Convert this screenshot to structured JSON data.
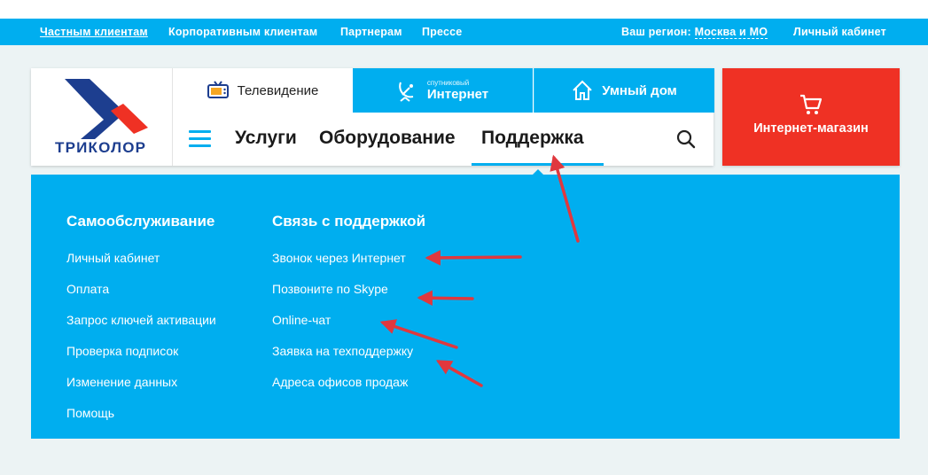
{
  "topbar": {
    "links": [
      "Частным клиентам",
      "Корпоративным клиентам",
      "Партнерам",
      "Прессе"
    ],
    "region_label": "Ваш регион:",
    "region_value": "Москва и МО",
    "account": "Личный кабинет"
  },
  "logo": {
    "text": "ТРИКОЛОР"
  },
  "tabs": {
    "tv": "Телевидение",
    "internet_small": "спутниковый",
    "internet": "Интернет",
    "home": "Умный дом"
  },
  "nav": [
    "Услуги",
    "Оборудование",
    "Поддержка"
  ],
  "shop": {
    "label": "Интернет-магазин"
  },
  "dropdown": {
    "self_service": {
      "title": "Самообслуживание",
      "items": [
        "Личный кабинет",
        "Оплата",
        "Запрос ключей активации",
        "Проверка подписок",
        "Изменение данных",
        "Помощь"
      ]
    },
    "contact": {
      "title": "Связь с поддержкой",
      "items": [
        "Звонок через Интернет",
        "Позвоните по Skype",
        "Online-чат",
        "Заявка на техподдержку",
        "Адреса офисов продаж"
      ]
    }
  },
  "colors": {
    "accent": "#00aeef",
    "brand_red": "#ef3124",
    "brand_blue": "#1d3e8f",
    "annotation": "#e0383e"
  },
  "icons": [
    "tv-icon",
    "satellite-icon",
    "home-icon",
    "menu-icon",
    "search-icon",
    "cart-icon"
  ]
}
